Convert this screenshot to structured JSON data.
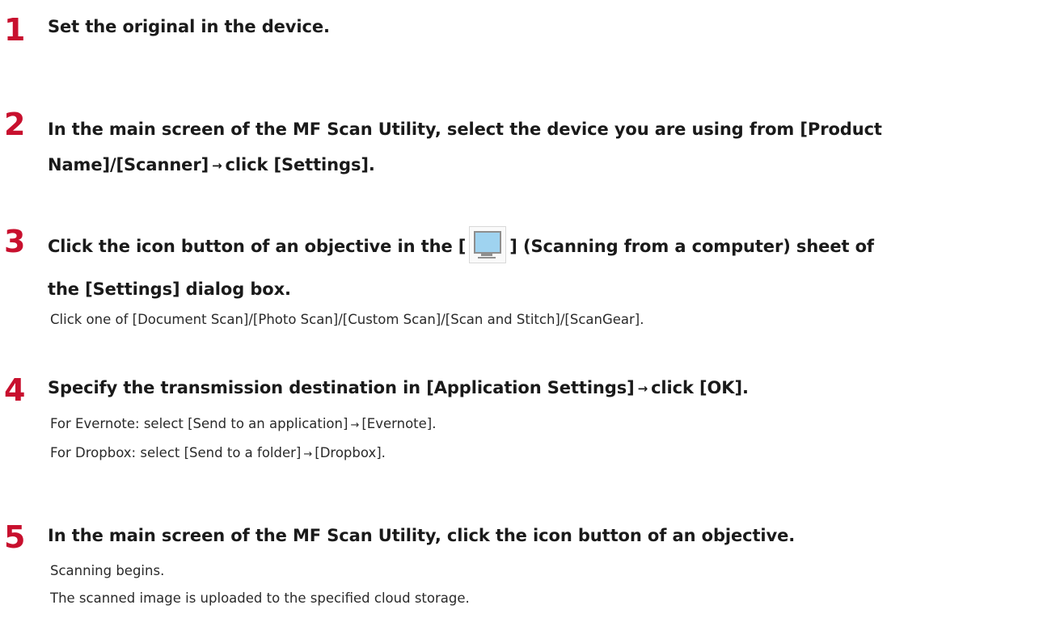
{
  "steps": [
    {
      "number": "1",
      "title_lines": [
        "Set the original in the device."
      ]
    },
    {
      "number": "2",
      "title_line1": "In the main screen of the MF Scan Utility, select the device you are using from [Product",
      "title_line2_a": "Name]/[Scanner]",
      "title_line2_arrow": "→",
      "title_line2_b": "click [Settings]."
    },
    {
      "number": "3",
      "title_line1_a": "Click the icon button of an objective in the [",
      "title_icon": "computer-monitor-icon",
      "title_line1_b": "] (Scanning from a computer) sheet of",
      "title_line2": "the [Settings] dialog box.",
      "body": [
        "Click one of [Document Scan]/[Photo Scan]/[Custom Scan]/[Scan and Stitch]/[ScanGear]."
      ]
    },
    {
      "number": "4",
      "title_a": "Specify the transmission destination in [Application Settings]",
      "title_arrow": "→",
      "title_b": "click [OK].",
      "body": [
        {
          "a": "For Evernote: select [Send to an application]",
          "arrow": "→",
          "b": "[Evernote]."
        },
        {
          "a": "For Dropbox: select [Send to a folder]",
          "arrow": "→",
          "b": "[Dropbox]."
        }
      ]
    },
    {
      "number": "5",
      "title": "In the main screen of the MF Scan Utility, click the icon button of an objective.",
      "body": [
        "Scanning begins.",
        "The scanned image is uploaded to the specified cloud storage."
      ]
    }
  ],
  "colors": {
    "step_number": "#c8102e",
    "text": "#1a1a1a",
    "monitor_screen": "#9fd3f0"
  }
}
